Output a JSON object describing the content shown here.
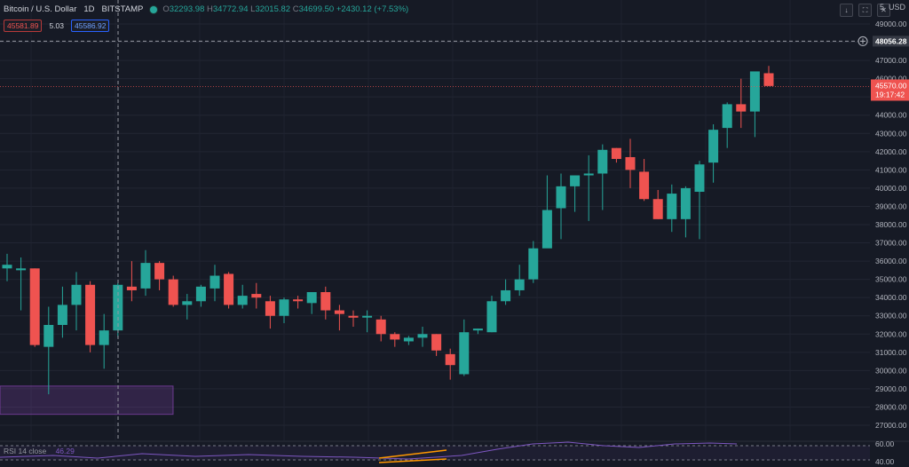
{
  "header": {
    "symbol": "Bitcoin / U.S. Dollar",
    "interval": "1D",
    "exchange": "BITSTAMP",
    "open_label": "O",
    "open": "32293.98",
    "high_label": "H",
    "high": "34772.94",
    "low_label": "L",
    "low": "32015.82",
    "close_label": "C",
    "close": "34699.50",
    "change": "+2430.12 (+7.53%)"
  },
  "trade": {
    "sell": "45581.89",
    "spread": "5.03",
    "buy": "45586.92"
  },
  "top_right": {
    "tag": "5",
    "currency": "USD"
  },
  "price_axis": {
    "labels": [
      "49000.00",
      "48000.00",
      "47000.00",
      "46000.00",
      "45000.00",
      "44000.00",
      "43000.00",
      "42000.00",
      "41000.00",
      "40000.00",
      "39000.00",
      "38000.00",
      "37000.00",
      "36000.00",
      "35000.00",
      "34000.00",
      "33000.00",
      "32000.00",
      "31000.00",
      "30000.00",
      "29000.00",
      "28000.00",
      "27000.00"
    ],
    "crosshair_price": "48056.28",
    "last_price": "45570.00",
    "countdown": "19:17:42"
  },
  "rsi": {
    "label": "RSI 14 close",
    "value": "46.29",
    "axis": [
      "60.00",
      "40.00"
    ]
  },
  "colors": {
    "up": "#26a69a",
    "down": "#ef5350",
    "bg": "#161a25",
    "zone": "#7b3fa0",
    "rsi": "#7e57c2",
    "trendline": "#ff9800"
  },
  "chart_data": {
    "type": "candlestick",
    "ylim": [
      27000,
      49500
    ],
    "candles": [
      [
        35600,
        36400,
        34900,
        35800
      ],
      [
        35500,
        36200,
        33300,
        35600
      ],
      [
        35600,
        35600,
        31300,
        31400
      ],
      [
        31300,
        33500,
        28700,
        32500
      ],
      [
        32500,
        34600,
        31800,
        33600
      ],
      [
        33600,
        35400,
        32200,
        34700
      ],
      [
        34700,
        34900,
        31000,
        31400
      ],
      [
        31400,
        33100,
        30100,
        32200
      ],
      [
        32200,
        34800,
        31800,
        34700
      ],
      [
        34600,
        36000,
        33800,
        34400
      ],
      [
        34500,
        36600,
        34100,
        35900
      ],
      [
        35900,
        36000,
        34400,
        35000
      ],
      [
        35000,
        35200,
        33500,
        33600
      ],
      [
        33600,
        34200,
        32800,
        33800
      ],
      [
        33800,
        34700,
        33500,
        34600
      ],
      [
        34500,
        35800,
        33800,
        35200
      ],
      [
        35300,
        35400,
        33400,
        33600
      ],
      [
        33600,
        34700,
        33400,
        34100
      ],
      [
        34200,
        34800,
        33400,
        34000
      ],
      [
        33800,
        34100,
        32300,
        33000
      ],
      [
        33000,
        34000,
        32600,
        33900
      ],
      [
        33900,
        34100,
        33400,
        33800
      ],
      [
        33700,
        34300,
        33100,
        34300
      ],
      [
        34300,
        34600,
        32800,
        33300
      ],
      [
        33300,
        33600,
        32200,
        33100
      ],
      [
        33000,
        33300,
        32400,
        32900
      ],
      [
        33000,
        33300,
        32100,
        33000
      ],
      [
        32800,
        33000,
        31600,
        32000
      ],
      [
        32000,
        32100,
        31300,
        31700
      ],
      [
        31600,
        31900,
        31400,
        31800
      ],
      [
        31800,
        32400,
        31300,
        32000
      ],
      [
        32000,
        32000,
        30800,
        31100
      ],
      [
        30900,
        31200,
        29500,
        30300
      ],
      [
        29800,
        32800,
        29700,
        32100
      ],
      [
        32200,
        32300,
        32000,
        32300
      ],
      [
        32100,
        34100,
        32100,
        33800
      ],
      [
        33800,
        35000,
        33600,
        34400
      ],
      [
        34400,
        35800,
        34100,
        35000
      ],
      [
        35000,
        37100,
        34800,
        36700
      ],
      [
        36700,
        40700,
        37000,
        38800
      ],
      [
        38900,
        40800,
        37200,
        40100
      ],
      [
        40100,
        40700,
        38700,
        40700
      ],
      [
        40700,
        41800,
        38200,
        40800
      ],
      [
        40800,
        42400,
        38800,
        42100
      ],
      [
        42200,
        42200,
        41400,
        41600
      ],
      [
        41700,
        42700,
        40000,
        41000
      ],
      [
        40900,
        41600,
        39300,
        39400
      ],
      [
        39400,
        39900,
        38300,
        38300
      ],
      [
        38300,
        40200,
        37600,
        39700
      ],
      [
        38300,
        40100,
        37300,
        40000
      ],
      [
        39800,
        41500,
        37200,
        41300
      ],
      [
        41400,
        43500,
        40300,
        43200
      ],
      [
        43300,
        44700,
        42200,
        44600
      ],
      [
        44600,
        46000,
        43300,
        44200
      ],
      [
        44200,
        46300,
        42800,
        46400
      ],
      [
        46300,
        46700,
        45600,
        45600
      ]
    ]
  }
}
